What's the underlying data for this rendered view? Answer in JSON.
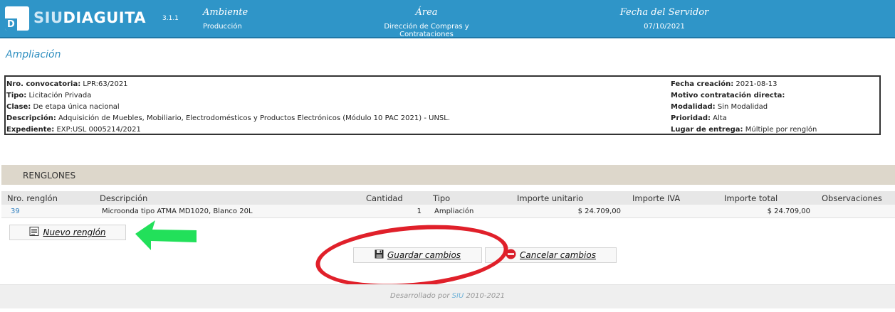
{
  "header": {
    "logo_prefix": "SIU",
    "logo_suffix": "DIAGUITA",
    "logo_mark": "D",
    "version": "3.1.1",
    "ambiente_label": "Ambiente",
    "ambiente_value": "Producción",
    "area_label": "Área",
    "area_value": "Dirección de Compras y Contrataciones",
    "fecha_label": "Fecha del Servidor",
    "fecha_value": "07/10/2021"
  },
  "page": {
    "title": "Ampliación"
  },
  "info": {
    "left": [
      {
        "label": "Nro. convocatoria:",
        "value": "LPR:63/2021"
      },
      {
        "label": "Tipo:",
        "value": "Licitación Privada"
      },
      {
        "label": "Clase:",
        "value": "De etapa única nacional"
      },
      {
        "label": "Descripción:",
        "value": "Adquisición de Muebles, Mobiliario, Electrodomésticos y Productos Electrónicos (Módulo 10 PAC 2021) - UNSL."
      },
      {
        "label": "Expediente:",
        "value": "EXP:USL 0005214/2021"
      }
    ],
    "right": [
      {
        "label": "Fecha creación:",
        "value": "2021-08-13"
      },
      {
        "label": "Motivo contratación directa:",
        "value": ""
      },
      {
        "label": "Modalidad:",
        "value": "Sin Modalidad"
      },
      {
        "label": "Prioridad:",
        "value": "Alta"
      },
      {
        "label": "Lugar de entrega:",
        "value": "Múltiple por renglón"
      }
    ]
  },
  "renglones": {
    "section_title": "RENGLONES",
    "columns": [
      "Nro. renglón",
      "Descripción",
      "Cantidad",
      "Tipo",
      "Importe unitario",
      "Importe IVA",
      "Importe total",
      "Observaciones"
    ],
    "rows": [
      {
        "nro": "39",
        "descripcion": "Microonda tipo ATMA MD1020, Blanco 20L",
        "cantidad": "1",
        "tipo": "Ampliación",
        "importe_unitario": "$ 24.709,00",
        "importe_iva": "",
        "importe_total": "$ 24.709,00",
        "observaciones": ""
      }
    ]
  },
  "actions": {
    "nuevo_renglon": "Nuevo renglón",
    "guardar": "Guardar cambios",
    "cancelar": "Cancelar cambios"
  },
  "footer": {
    "prefix": "Desarrollado por",
    "brand": "SIU",
    "years": "2010-2021"
  },
  "colors": {
    "header_bg": "#2f95c8",
    "title": "#2f8fc0",
    "section_bar": "#ddd7cb",
    "annotation_red": "#e0202a",
    "annotation_green": "#22e05a"
  },
  "icons": {
    "nuevo": "list-document-icon",
    "guardar": "floppy-disk-icon",
    "cancelar": "no-entry-icon"
  }
}
